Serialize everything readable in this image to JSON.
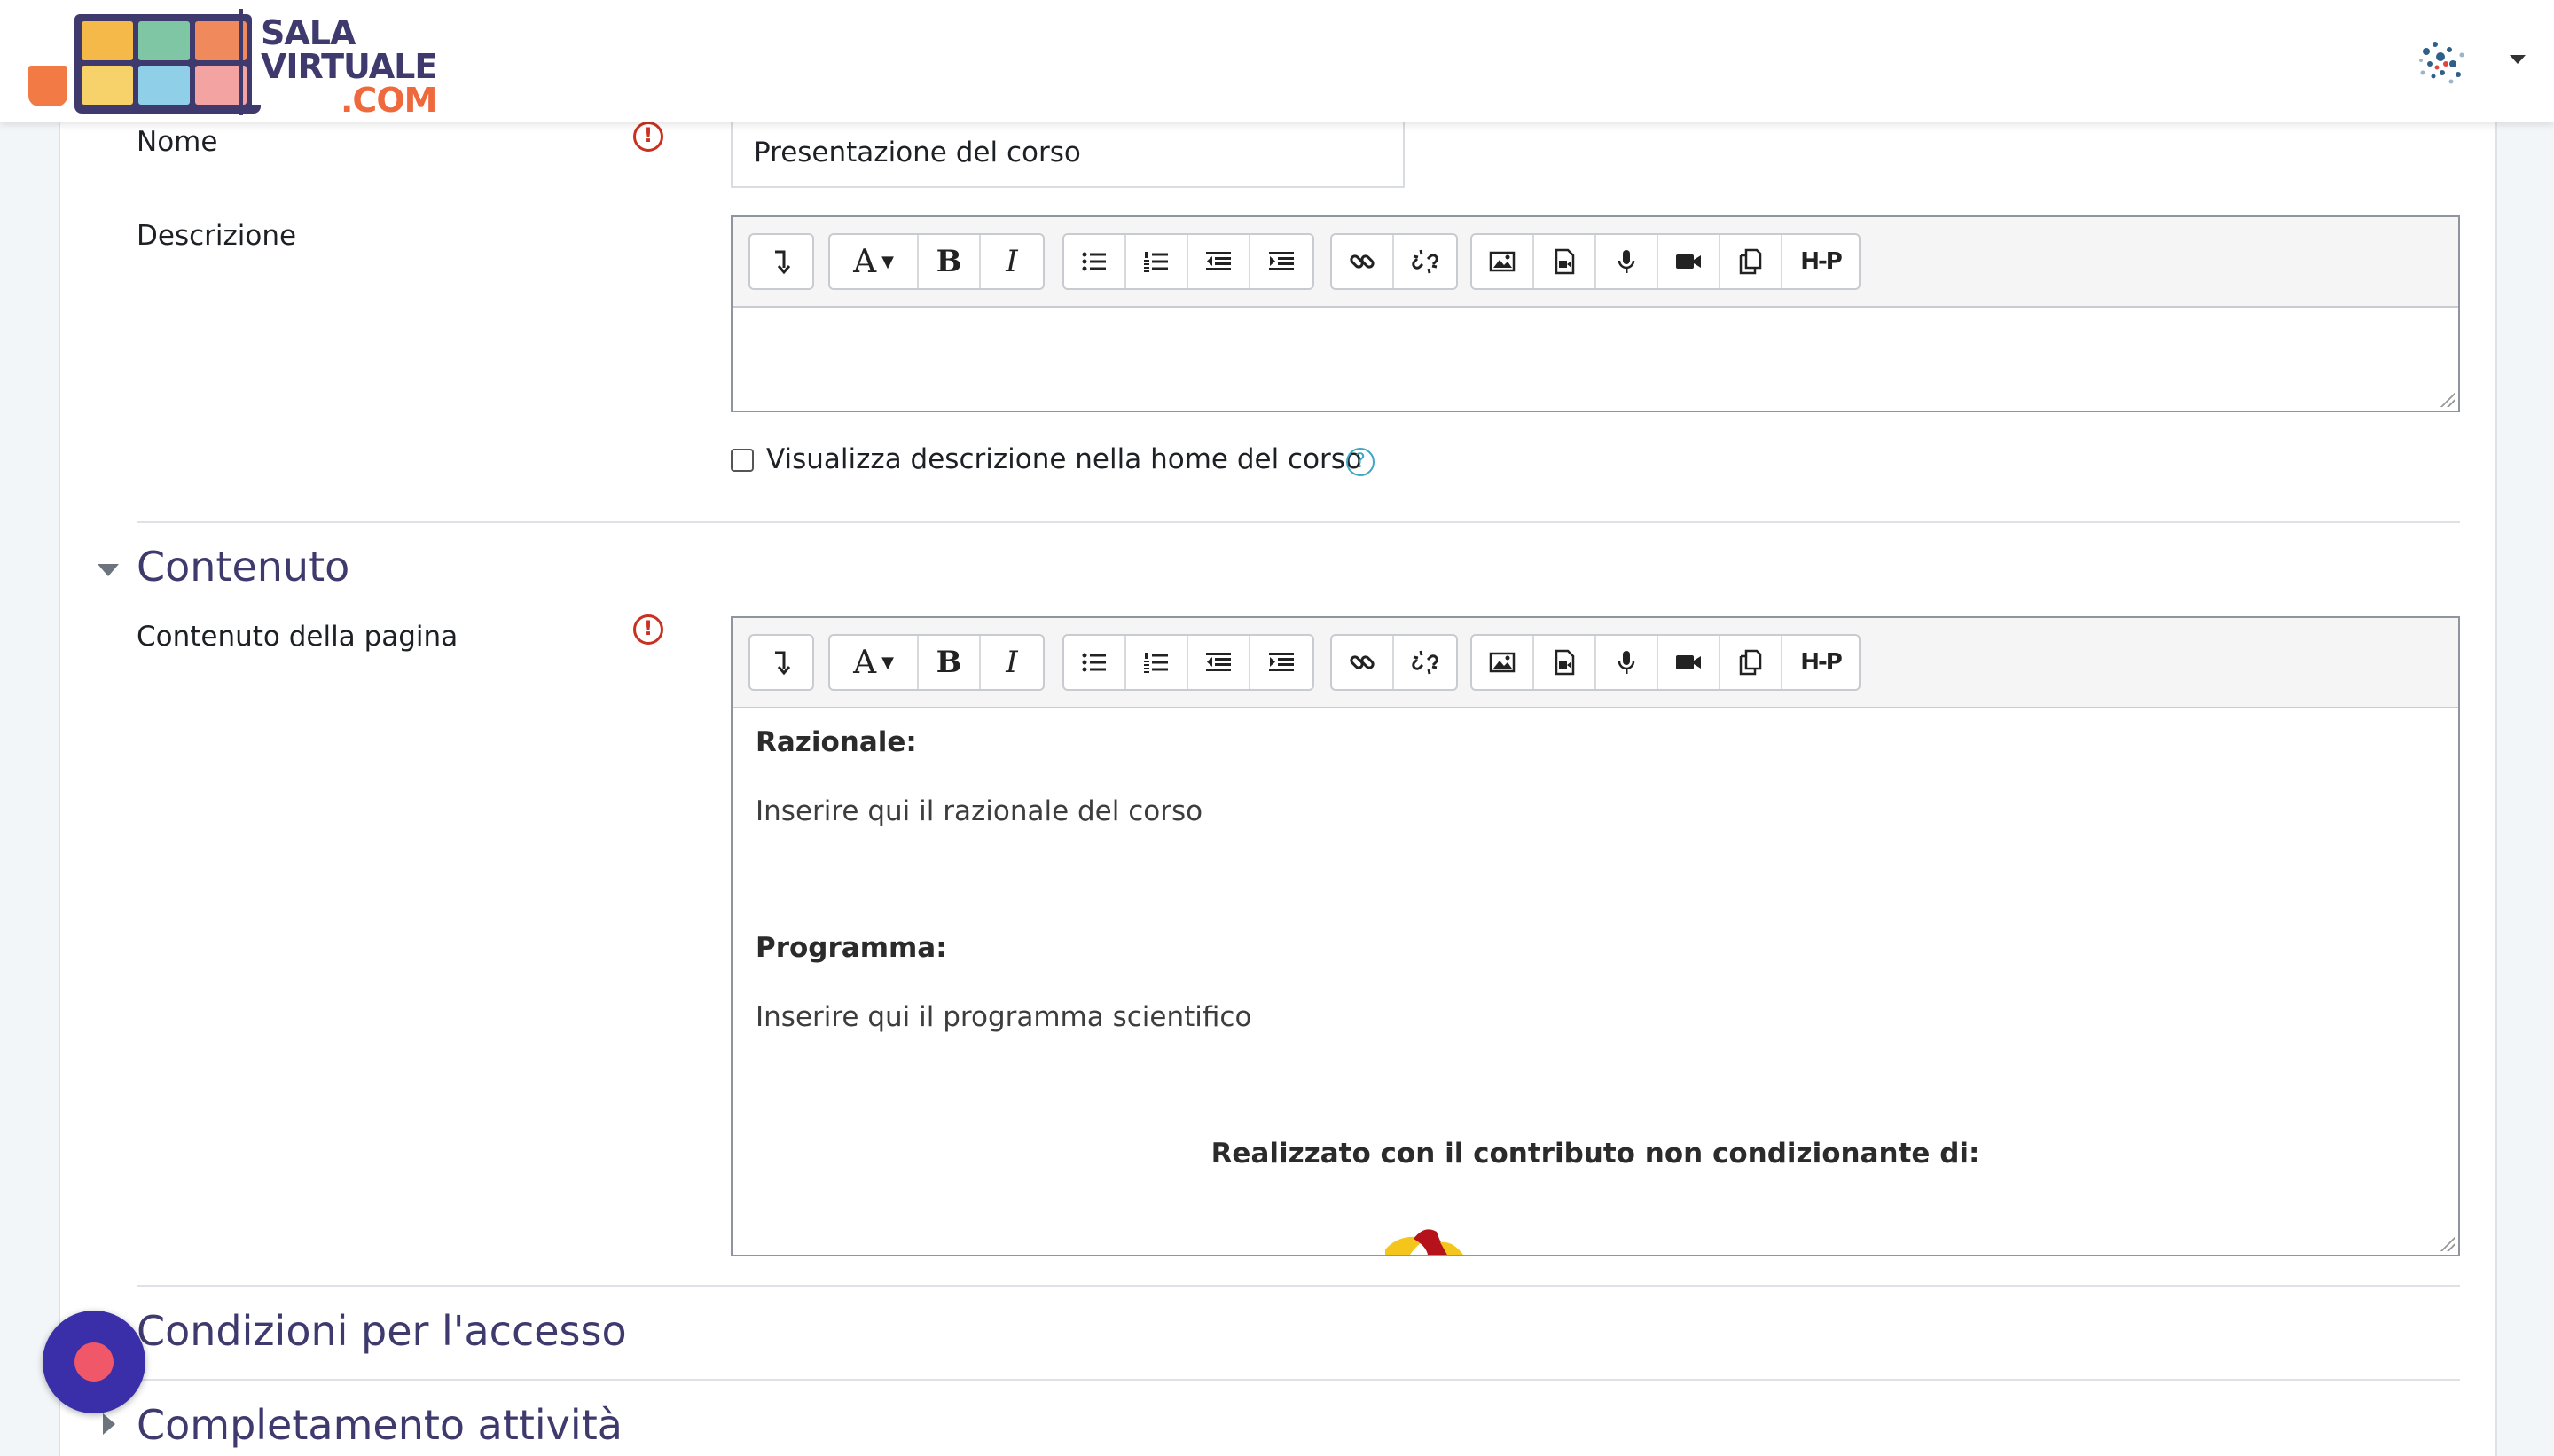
{
  "brand": {
    "logo_line1": "SALA",
    "logo_line2": "VIRTUALE",
    "logo_line3": ".COM",
    "colors": {
      "primary": "#3f3a6e",
      "accent": "#ee6a3c"
    }
  },
  "form": {
    "nome_label": "Nome",
    "nome_value": "Presentazione del corso",
    "descrizione_label": "Descrizione",
    "show_description_label": "Visualizza descrizione nella home del corso",
    "show_description_checked": false
  },
  "sections": {
    "contenuto_title": "Contenuto",
    "contenuto_pagina_label": "Contenuto della pagina",
    "condizioni_title": "Condizioni per l'accesso",
    "completamento_title": "Completamento attività"
  },
  "editor_content": {
    "razionale_heading": "Razionale:",
    "razionale_text": "Inserire qui il razionale del corso",
    "programma_heading": "Programma:",
    "programma_text": "Inserire qui il programma scientifico",
    "sponsor_text": "Realizzato con il contributo non condizionante di:"
  },
  "toolbar": {
    "icons": [
      "collapse-icon",
      "font-color-icon",
      "bold-icon",
      "italic-icon",
      "unordered-list-icon",
      "ordered-list-icon",
      "outdent-icon",
      "indent-icon",
      "link-icon",
      "unlink-icon",
      "image-icon",
      "media-icon",
      "record-audio-icon",
      "record-video-icon",
      "manage-files-icon",
      "h5p-icon"
    ],
    "bold_glyph": "B",
    "italic_glyph": "I",
    "font_glyph": "A",
    "h5p_glyph": "H-P"
  }
}
